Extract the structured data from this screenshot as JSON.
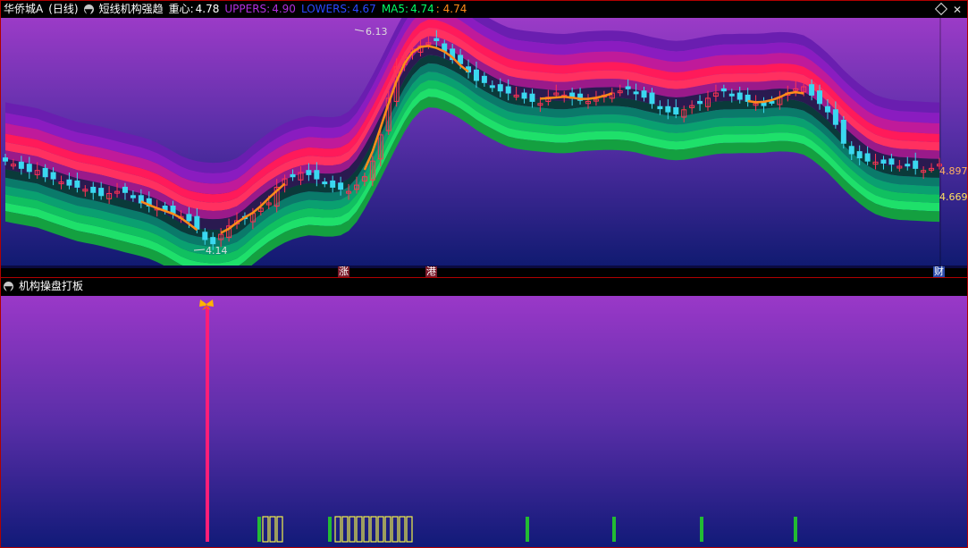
{
  "main": {
    "stock_name": "华侨城A",
    "period": "(日线)",
    "indicator_name": "短线机构强趋",
    "center_label": "重心:",
    "center_value": "4.78",
    "uppers_label": "UPPERS:",
    "uppers_value": "4.90",
    "lowers_label": "LOWERS:",
    "lowers_value": "4.67",
    "ma5_label": "MA5:",
    "ma5_value1": "4.74",
    "ma5_value2": ": 4.74",
    "high_label": "6.13",
    "low_label": "4.14",
    "right_label_upper": "4.897",
    "right_label_lower": "4.669",
    "bottom_tags": [
      "涨",
      "港",
      "财"
    ]
  },
  "sub": {
    "indicator_name": "机构操盘打板"
  },
  "colors": {
    "up_candle": "#ff3355",
    "down_candle": "#3ad8f0",
    "ma_line": "#ff8c1a",
    "uppers": "#b030e0",
    "lowers": "#2040ff",
    "ma5": "#00ff66",
    "signal_line": "#ff1e78",
    "green_bar": "#22bb33",
    "yellow_box": "#f3f34a"
  },
  "chart_data": [
    {
      "type": "candlestick",
      "title": "短线机构强趋",
      "price_range": [
        4.14,
        6.13
      ],
      "annotations": {
        "high": 6.13,
        "low": 4.14,
        "center": 4.78,
        "uppers": 4.9,
        "lowers": 4.67,
        "ma5": 4.74
      },
      "close_series": [
        4.95,
        4.92,
        4.88,
        4.85,
        4.86,
        4.8,
        4.78,
        4.75,
        4.72,
        4.7,
        4.68,
        4.65,
        4.62,
        4.64,
        4.66,
        4.65,
        4.6,
        4.55,
        4.52,
        4.5,
        4.48,
        4.45,
        4.42,
        4.38,
        4.3,
        4.2,
        4.16,
        4.25,
        4.33,
        4.38,
        4.4,
        4.45,
        4.5,
        4.55,
        4.7,
        4.78,
        4.8,
        4.84,
        4.82,
        4.78,
        4.74,
        4.7,
        4.68,
        4.66,
        4.72,
        4.8,
        4.95,
        5.2,
        5.55,
        5.85,
        5.95,
        6.02,
        6.05,
        6.08,
        6.1,
        6.0,
        5.92,
        5.88,
        5.8,
        5.72,
        5.7,
        5.66,
        5.62,
        5.6,
        5.58,
        5.55,
        5.52,
        5.5,
        5.56,
        5.6,
        5.58,
        5.55,
        5.53,
        5.52,
        5.54,
        5.58,
        5.6,
        5.62,
        5.64,
        5.6,
        5.56,
        5.5,
        5.45,
        5.42,
        5.4,
        5.44,
        5.48,
        5.5,
        5.55,
        5.6,
        5.62,
        5.58,
        5.54,
        5.52,
        5.5,
        5.48,
        5.52,
        5.56,
        5.6,
        5.64,
        5.66,
        5.58,
        5.5,
        5.42,
        5.3,
        5.12,
        5.02,
        4.98,
        4.95,
        4.94,
        4.93,
        4.92,
        4.9,
        4.91,
        4.88,
        4.86,
        4.88,
        4.92
      ]
    },
    {
      "type": "bar",
      "title": "机构操盘打板",
      "signal_marker": "butterfly",
      "series": [
        {
          "name": "",
          "kind": "signal_line",
          "positions": [
            231
          ]
        },
        {
          "name": "",
          "kind": "green_bar",
          "positions": [
            289,
            368,
            589,
            686,
            784,
            889
          ]
        },
        {
          "name": "",
          "kind": "yellow_box",
          "positions": [
            296,
            304,
            312,
            377,
            385,
            393,
            401,
            409,
            417,
            425,
            433,
            441,
            449,
            457
          ]
        }
      ]
    }
  ]
}
